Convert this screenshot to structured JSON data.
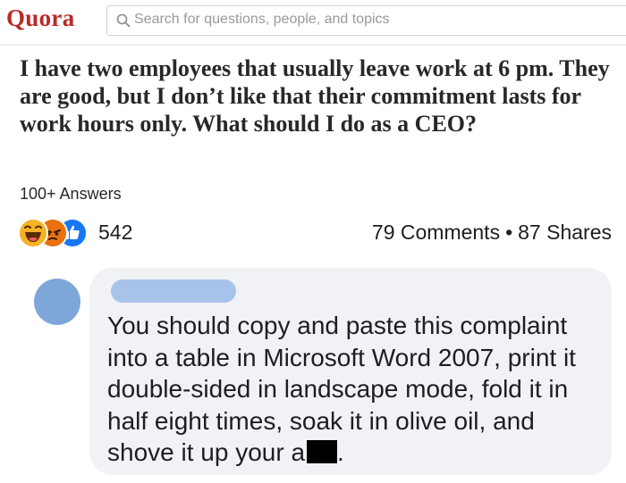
{
  "header": {
    "logo": "Quora",
    "search_placeholder": "Search for questions, people, and topics"
  },
  "question": {
    "title": "I have two employees that usually leave work at 6 pm. They are good, but I don’t like that their commitment lasts for work hours only. What should I do as a CEO?",
    "answers_count": "100+ Answers"
  },
  "reactions": {
    "icons": [
      "haha-icon",
      "angry-icon",
      "like-icon"
    ],
    "count": "542",
    "comments": "79 Comments",
    "separator": "•",
    "shares": "87 Shares"
  },
  "comment": {
    "text_before": "You should copy and paste this complaint into a table in Microsoft Word 2007, print it double-sided in landscape mode, fold it in half eight times, soak it in olive oil, and shove it up your a",
    "text_after": "."
  },
  "colors": {
    "quora_red": "#b92b27",
    "avatar_blue": "#7fa6d8",
    "name_bar_blue": "#a8c3ea",
    "bubble_bg": "#f0f2f5",
    "like_blue": "#1877f2",
    "angry_orange": "#e9710f",
    "haha_yellow": "#f7b125"
  }
}
